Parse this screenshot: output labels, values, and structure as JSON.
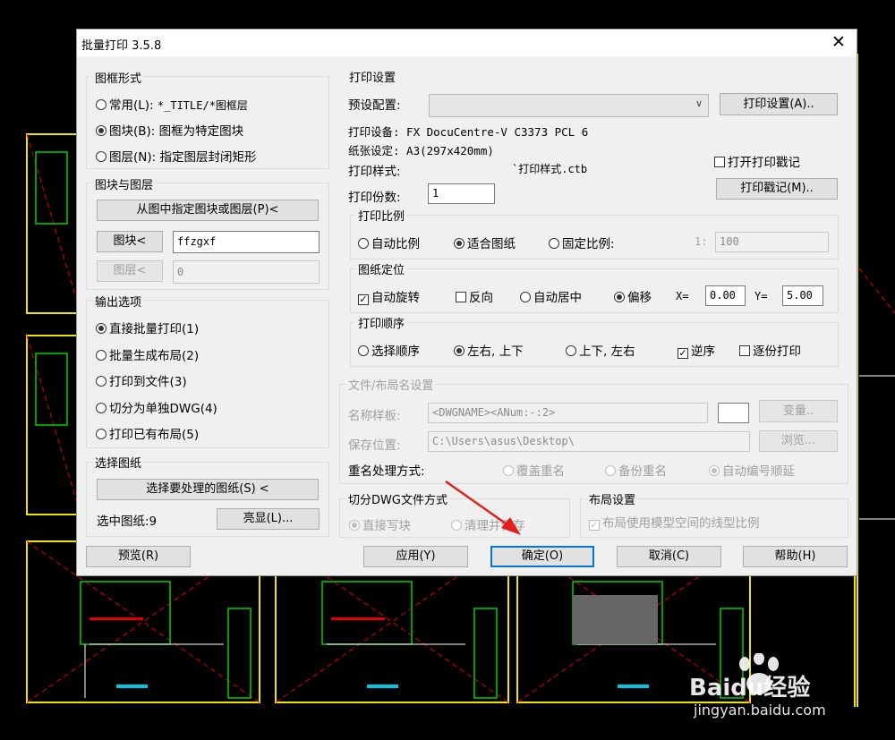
{
  "window": {
    "title": "批量打印 3.5.8",
    "close_glyph": "✕"
  },
  "frame_style": {
    "label": "图框形式",
    "options": [
      {
        "label": "常用(L):",
        "desc": "*_TITLE/*图框层",
        "checked": false
      },
      {
        "label": "图块(B):",
        "desc": "图框为特定图块",
        "checked": true
      },
      {
        "label": "图层(N):",
        "desc": "指定图层封闭矩形",
        "checked": false
      }
    ]
  },
  "block_layer": {
    "label": "图块与图层",
    "pick_button": "从图中指定图块或图层(P)<",
    "block_button": "图块<",
    "block_value": "ffzgxf",
    "layer_button": "图层<",
    "layer_value": "0"
  },
  "output": {
    "label": "输出选项",
    "options": [
      {
        "label": "直接批量打印(1)",
        "checked": true
      },
      {
        "label": "批量生成布局(2)",
        "checked": false
      },
      {
        "label": "打印到文件(3)",
        "checked": false
      },
      {
        "label": "切分为单独DWG(4)",
        "checked": false
      },
      {
        "label": "打印已有布局(5)",
        "checked": false
      }
    ]
  },
  "select_drawing": {
    "label": "选择图纸",
    "select_button": "选择要处理的图纸(S) <",
    "selected_text": "选中图纸:9",
    "highlight_button": "亮显(L)..."
  },
  "print_settings": {
    "label": "打印设置",
    "preset_label": "预设配置:",
    "preset_value": "",
    "settings_button": "打印设置(A)..",
    "device": "打印设备: FX DocuCentre-V C3373 PCL 6",
    "paper": "纸张设定: A3(297x420mm)",
    "style_label": "打印样式:",
    "style_value": "`打印样式.ctb",
    "stamp_check_label": "打开打印戳记",
    "stamp_checked": false,
    "copies_label": "打印份数:",
    "copies_value": "1",
    "stamp_button": "打印戳记(M).."
  },
  "scale": {
    "label": "打印比例",
    "options": [
      {
        "label": "自动比例",
        "checked": false
      },
      {
        "label": "适合图纸",
        "checked": true
      },
      {
        "label": "固定比例:",
        "checked": false
      }
    ],
    "ratio_label": "1:",
    "ratio_value": "100"
  },
  "position": {
    "label": "图纸定位",
    "auto_rotate": "自动旋转",
    "auto_rotate_checked": true,
    "reverse": "反向",
    "reverse_checked": false,
    "auto_center": "自动居中",
    "auto_center_checked": false,
    "offset": "偏移",
    "offset_checked": true,
    "x_label": "X=",
    "x_value": "0.00",
    "y_label": "Y=",
    "y_value": "5.00"
  },
  "order": {
    "label": "打印顺序",
    "options": [
      {
        "label": "选择顺序",
        "checked": false
      },
      {
        "label": "左右, 上下",
        "checked": true
      },
      {
        "label": "上下, 左右",
        "checked": false
      }
    ],
    "reverse": "逆序",
    "reverse_checked": true,
    "collate": "逐份打印",
    "collate_checked": false
  },
  "file_layout": {
    "label": "文件/布局名设置",
    "name_label": "名称样板:",
    "name_value": "<DWGNAME><ANum:-:2>",
    "var_button": "变量..",
    "save_label": "保存位置:",
    "save_value": "C:\\Users\\asus\\Desktop\\",
    "browse_button": "浏览...",
    "rename_label": "重名处理方式:",
    "rename_options": [
      {
        "label": "覆盖重名",
        "checked": false
      },
      {
        "label": "备份重名",
        "checked": false
      },
      {
        "label": "自动编号顺延",
        "checked": true
      }
    ]
  },
  "split_dwg": {
    "label": "切分DWG文件方式",
    "options": [
      {
        "label": "直接写块",
        "checked": true
      },
      {
        "label": "清理并保存",
        "checked": false
      }
    ]
  },
  "layout_settings": {
    "label": "布局设置",
    "check_label": "布局使用模型空间的线型比例",
    "checked": true
  },
  "footer": {
    "preview": "预览(R)",
    "apply": "应用(Y)",
    "ok": "确定(O)",
    "cancel": "取消(C)",
    "help": "帮助(H)"
  },
  "watermark": {
    "brand": "Baidu经验",
    "url": "jingyan.baidu.com"
  },
  "colors": {
    "cad_yellow": "#f0e600",
    "cad_green": "#00d000",
    "cad_red": "#e00000",
    "cad_cyan": "#00c8e0",
    "annotation_arrow": "#e02020",
    "focus": "#0078d7"
  }
}
